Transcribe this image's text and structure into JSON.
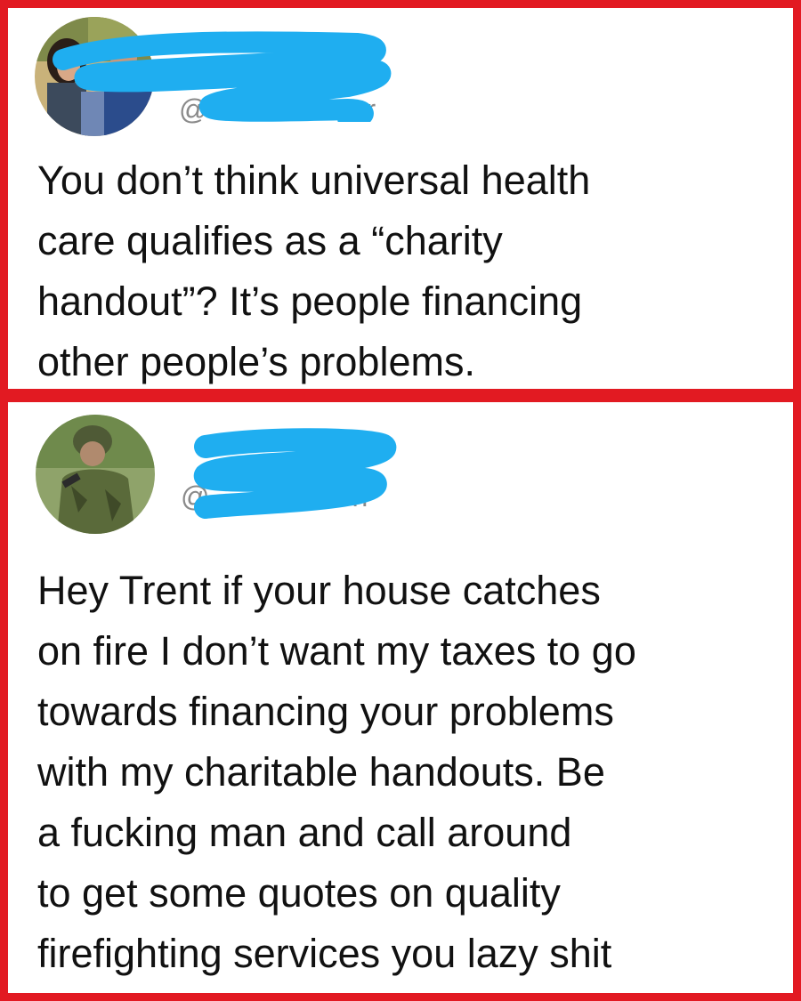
{
  "tweets": [
    {
      "handle_visible": "@",
      "handle_tail": "r",
      "text": "You don’t think universal health\ncare qualifies as a “charity\nhandout”? It’s people financing\nother people’s problems."
    },
    {
      "handle_visible": "@",
      "handle_tail": "n",
      "text": "Hey Trent if your house catches\non fire I don’t want my taxes to go\ntowards financing your problems\nwith my charitable handouts. Be\na fucking man and call around\nto get some quotes on quality\nfirefighting services you lazy shit"
    }
  ],
  "colors": {
    "frame": "#e21a22",
    "redaction": "#1faef0",
    "handle": "#8a8a8a"
  },
  "icons": [
    "avatar-family-photo",
    "avatar-soldier-photo",
    "redaction-scribble"
  ]
}
